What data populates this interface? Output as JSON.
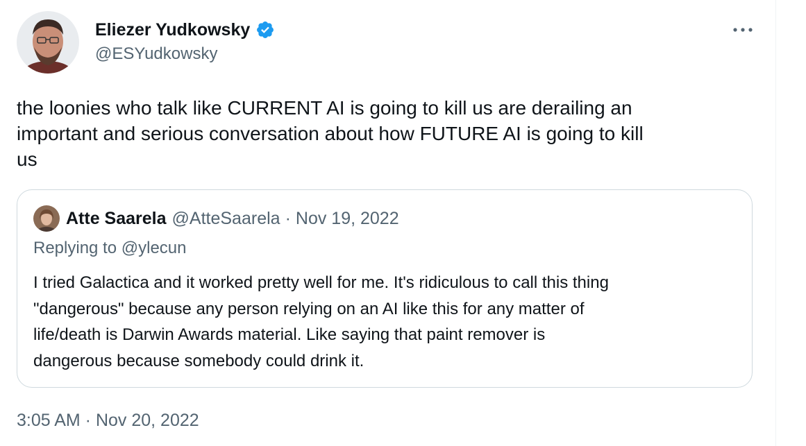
{
  "author": {
    "name": "Eliezer Yudkowsky",
    "handle": "@ESYudkowsky",
    "verified": true
  },
  "tweet": {
    "text": "the loonies who talk like CURRENT AI is going to kill us are derailing an\nimportant and serious conversation about how FUTURE AI is going to kill\nus"
  },
  "quote": {
    "name": "Atte Saarela",
    "handle": "@AtteSaarela",
    "separator": "·",
    "date": "Nov 19, 2022",
    "replying_prefix": "Replying to",
    "replying_to": "@ylecun",
    "text_lines": [
      "I tried Galactica and it worked pretty well for me. It's ridiculous to call this thing",
      "\"dangerous\" because any person relying on an AI like this for any matter of",
      "life/death is Darwin Awards material. Like saying that paint remover is",
      "dangerous because somebody could drink it."
    ]
  },
  "timestamp": "3:05 AM · Nov 20, 2022",
  "icons": {
    "verified": "verified-badge-icon",
    "more": "more-options-icon"
  },
  "colors": {
    "text_primary": "#0f1419",
    "text_secondary": "#536471",
    "verified_blue": "#1d9bf0",
    "card_border": "#cfd9de"
  }
}
